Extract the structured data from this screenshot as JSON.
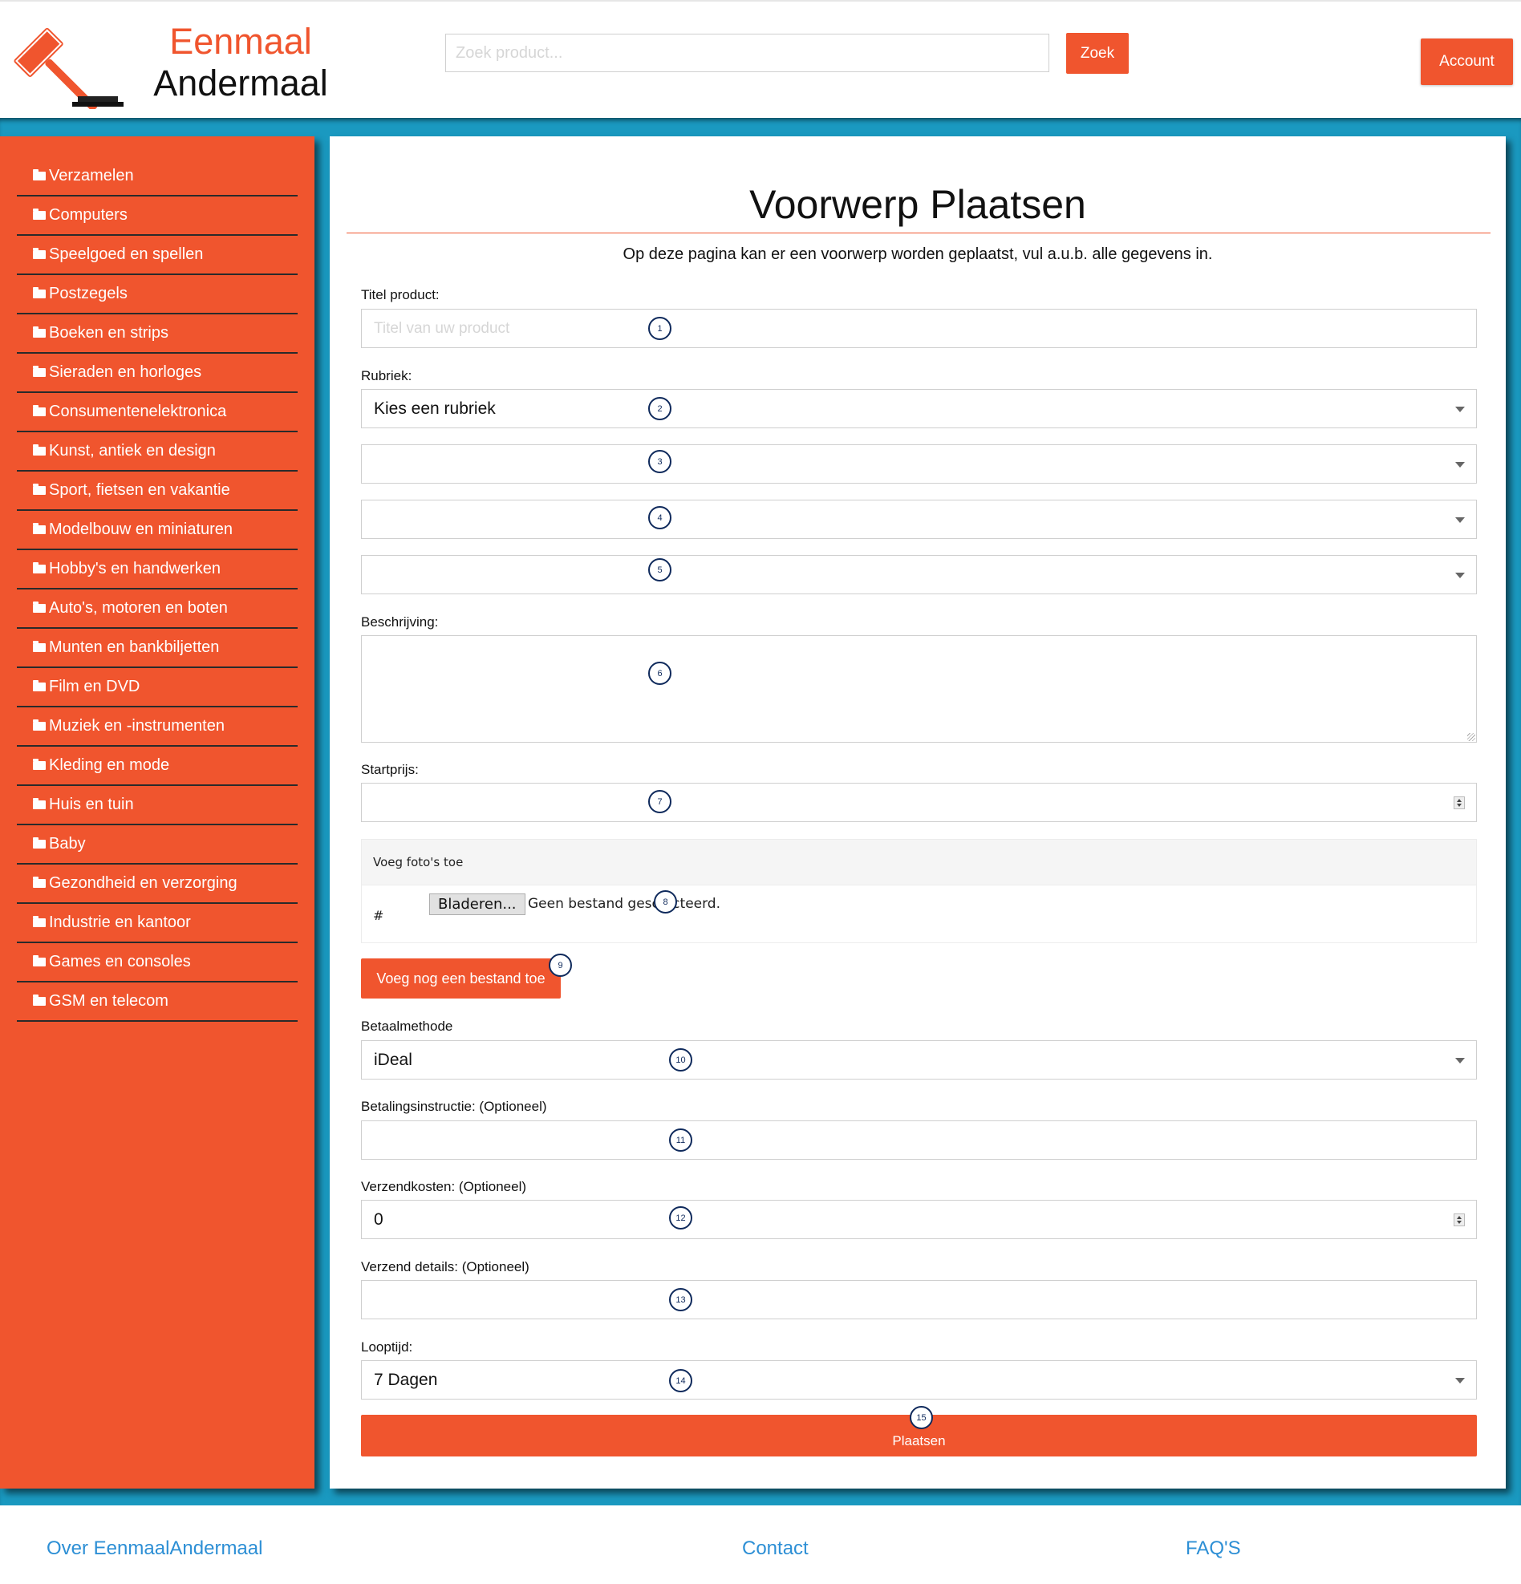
{
  "brand": {
    "name_line1": "Eenmaal",
    "name_line2": "Andermaal",
    "logo_icon": "gavel-icon",
    "accent_color": "#f0552e"
  },
  "header": {
    "search_placeholder": "Zoek product...",
    "search_button": "Zoek",
    "account_button": "Account"
  },
  "sidebar": {
    "items": [
      {
        "label": "Verzamelen",
        "icon": "folder-icon"
      },
      {
        "label": "Computers",
        "icon": "folder-icon"
      },
      {
        "label": "Speelgoed en spellen",
        "icon": "folder-icon"
      },
      {
        "label": "Postzegels",
        "icon": "folder-icon"
      },
      {
        "label": "Boeken en strips",
        "icon": "folder-icon"
      },
      {
        "label": "Sieraden en horloges",
        "icon": "folder-icon"
      },
      {
        "label": "Consumentenelektronica",
        "icon": "folder-icon"
      },
      {
        "label": "Kunst, antiek en design",
        "icon": "folder-icon"
      },
      {
        "label": "Sport, fietsen en vakantie",
        "icon": "folder-icon"
      },
      {
        "label": "Modelbouw en miniaturen",
        "icon": "folder-icon"
      },
      {
        "label": "Hobby's en handwerken",
        "icon": "folder-icon"
      },
      {
        "label": "Auto's, motoren en boten",
        "icon": "folder-icon"
      },
      {
        "label": "Munten en bankbiljetten",
        "icon": "folder-icon"
      },
      {
        "label": "Film en DVD",
        "icon": "folder-icon"
      },
      {
        "label": "Muziek en -instrumenten",
        "icon": "folder-icon"
      },
      {
        "label": "Kleding en mode",
        "icon": "folder-icon"
      },
      {
        "label": "Huis en tuin",
        "icon": "folder-icon"
      },
      {
        "label": "Baby",
        "icon": "folder-icon"
      },
      {
        "label": "Gezondheid en verzorging",
        "icon": "folder-icon"
      },
      {
        "label": "Industrie en kantoor",
        "icon": "folder-icon"
      },
      {
        "label": "Games en consoles",
        "icon": "folder-icon"
      },
      {
        "label": "GSM en telecom",
        "icon": "folder-icon"
      }
    ]
  },
  "form": {
    "title": "Voorwerp Plaatsen",
    "subtitle": "Op deze pagina kan er een voorwerp worden geplaatst, vul a.u.b. alle gegevens in.",
    "title_label": "Titel product:",
    "title_placeholder": "Titel van uw product",
    "title_value": "",
    "rubriek_label": "Rubriek:",
    "rubriek_value": "Kies een rubriek",
    "sub_rubriek_2": "",
    "sub_rubriek_3": "",
    "sub_rubriek_4": "",
    "beschrijving_label": "Beschrijving:",
    "beschrijving_value": "",
    "startprijs_label": "Startprijs:",
    "startprijs_value": "",
    "upload_heading": "Voeg foto's toe",
    "upload_row_hash": "#",
    "browse_button": "Bladeren...",
    "no_file_text": "Geen bestand geselecteerd.",
    "add_file_button": "Voeg nog een bestand toe",
    "betaalmethode_label": "Betaalmethode",
    "betaalmethode_value": "iDeal",
    "betalingsinstructie_label": "Betalingsinstructie: (Optioneel)",
    "betalingsinstructie_value": "",
    "verzendkosten_label": "Verzendkosten: (Optioneel)",
    "verzendkosten_value": "0",
    "verzenddetails_label": "Verzend details: (Optioneel)",
    "verzenddetails_value": "",
    "looptijd_label": "Looptijd:",
    "looptijd_value": "7 Dagen",
    "submit_button": "Plaatsen"
  },
  "markers": [
    "1",
    "2",
    "3",
    "4",
    "5",
    "6",
    "7",
    "8",
    "9",
    "10",
    "11",
    "12",
    "13",
    "14",
    "15"
  ],
  "footer": {
    "links": [
      "Over EenmaalAndermaal",
      "Contact",
      "FAQ'S"
    ],
    "link_color": "#2d8fd5"
  }
}
